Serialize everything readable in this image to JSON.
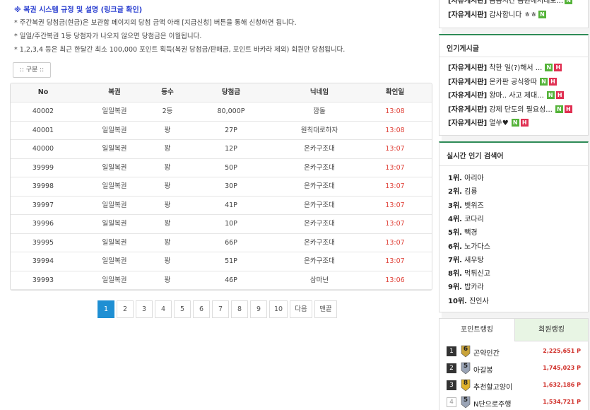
{
  "notice": {
    "title": "※ 복권 시스템 규정 및 설명 (링크글 확인)",
    "lines": [
      "* 주간복권 당첨금(현금)은 보관함 페이지의 당첨 금액 아래 [지급신청] 버튼을 통해 신청하면 됩니다.",
      "* 일일/주간복권 1등 당첨자가 나오지 않으면 당첨금은 이월됩니다.",
      "* 1,2,3,4 등은 최근 한달간 최소 100,000 포인트 획득(복권 당첨금/판매금, 포인트 바카라 제외) 회원만 당첨됩니다."
    ]
  },
  "filter": {
    "category_label": ":: 구분 ::"
  },
  "table": {
    "headers": [
      "No",
      "복권",
      "등수",
      "당첨금",
      "닉네임",
      "확인일"
    ],
    "rows": [
      [
        "40002",
        "일일복권",
        "2등",
        "80,000P",
        "깜돌",
        "13:08"
      ],
      [
        "40001",
        "일일복권",
        "꽝",
        "27P",
        "원칙대로하자",
        "13:08"
      ],
      [
        "40000",
        "일일복권",
        "꽝",
        "12P",
        "온카구조대",
        "13:07"
      ],
      [
        "39999",
        "일일복권",
        "꽝",
        "50P",
        "온카구조대",
        "13:07"
      ],
      [
        "39998",
        "일일복권",
        "꽝",
        "30P",
        "온카구조대",
        "13:07"
      ],
      [
        "39997",
        "일일복권",
        "꽝",
        "41P",
        "온카구조대",
        "13:07"
      ],
      [
        "39996",
        "일일복권",
        "꽝",
        "10P",
        "온카구조대",
        "13:07"
      ],
      [
        "39995",
        "일일복권",
        "꽝",
        "66P",
        "온카구조대",
        "13:07"
      ],
      [
        "39994",
        "일일복권",
        "꽝",
        "51P",
        "온카구조대",
        "13:07"
      ],
      [
        "39993",
        "일일복권",
        "꽝",
        "46P",
        "삼마넌",
        "13:06"
      ]
    ]
  },
  "pagination": {
    "pages": [
      "1",
      "2",
      "3",
      "4",
      "5",
      "6",
      "7",
      "8",
      "9",
      "10"
    ],
    "current": "1",
    "next_label": "다음",
    "last_label": "맨끝"
  },
  "sidebar": {
    "recent_posts": [
      {
        "board": "[자유게시판]",
        "title": "감사합니다 ㅎㅎ",
        "badges": [
          "N"
        ]
      }
    ],
    "popular": {
      "title": "인기게시글",
      "posts": [
        {
          "board": "[자유게시판]",
          "title": "착한 일(?)해서 ...",
          "badges": [
            "N",
            "H"
          ]
        },
        {
          "board": "[자유게시판]",
          "title": "온카판 공식왕따",
          "badges": [
            "N",
            "H"
          ]
        },
        {
          "board": "[자유게시판]",
          "title": "왕마.. 사고 제대...",
          "badges": [
            "N",
            "H"
          ]
        },
        {
          "board": "[자유게시판]",
          "title": "강제 단도의 필요성...",
          "badges": [
            "N",
            "H"
          ]
        },
        {
          "board": "[자유게시판]",
          "title": "얼쑤♥",
          "badges": [
            "N",
            "H"
          ]
        }
      ]
    },
    "realtime": {
      "title": "실시간 인기 검색어",
      "items": [
        {
          "rank": "1위.",
          "term": "아리아"
        },
        {
          "rank": "2위.",
          "term": "김룡"
        },
        {
          "rank": "3위.",
          "term": "벳위즈"
        },
        {
          "rank": "4위.",
          "term": "코다리"
        },
        {
          "rank": "5위.",
          "term": "빽경"
        },
        {
          "rank": "6위.",
          "term": "노가다스"
        },
        {
          "rank": "7위.",
          "term": "새우탕"
        },
        {
          "rank": "8위.",
          "term": "먹튀신고"
        },
        {
          "rank": "9위.",
          "term": "밥카라"
        },
        {
          "rank": "10위.",
          "term": "진인사"
        }
      ]
    },
    "ranking": {
      "tabs": [
        "포인트랭킹",
        "회원랭킹"
      ],
      "active_tab": "포인트랭킹",
      "items": [
        {
          "num": "1",
          "level": "6",
          "name": "곤약인간",
          "points": "2,225,651 P"
        },
        {
          "num": "2",
          "level": "5",
          "name": "아갈봉",
          "points": "1,745,023 P"
        },
        {
          "num": "3",
          "level": "8",
          "name": "추천할고양이",
          "points": "1,632,186 P"
        },
        {
          "num": "4",
          "level": "5",
          "name": "N단으로주행",
          "points": "1,534,721 P"
        }
      ]
    }
  },
  "colors": {
    "accent_blue": "#1f8fd3",
    "time_red": "#e0443b",
    "badge_new": "#55b33a",
    "badge_hot": "#e03052",
    "panel_green": "#2e8b57"
  }
}
